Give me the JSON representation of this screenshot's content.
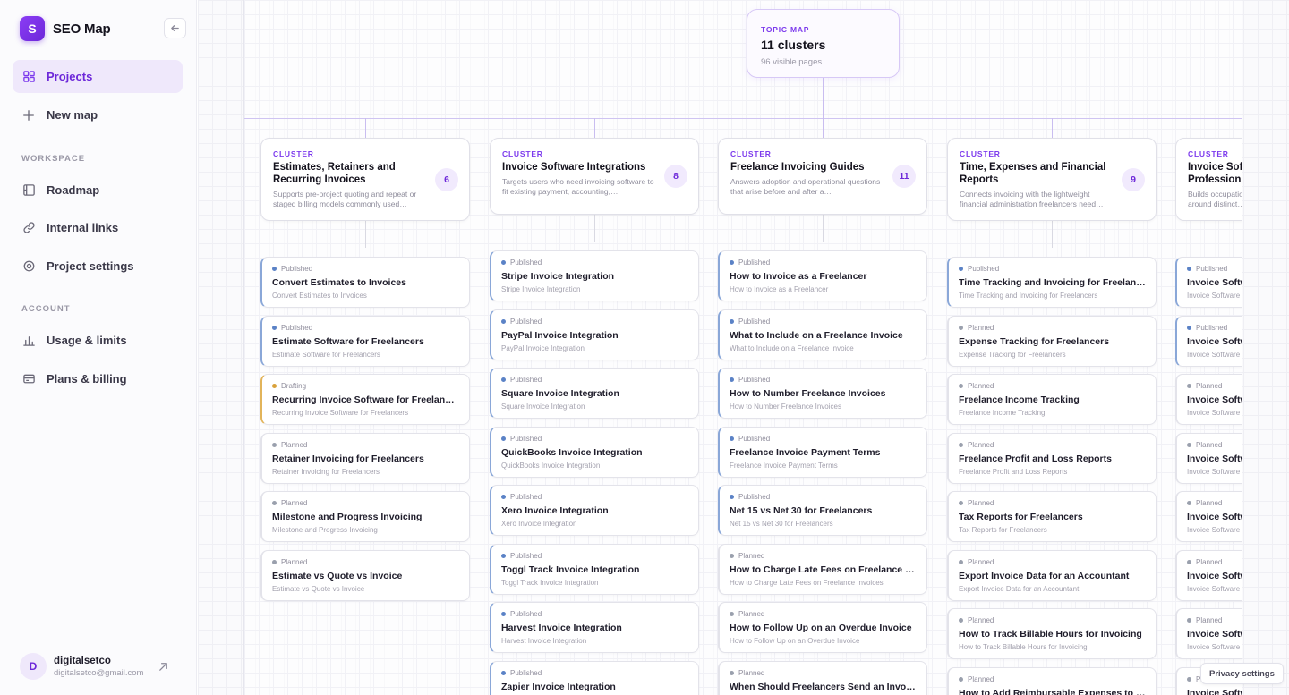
{
  "app": {
    "logo_letter": "S",
    "name": "SEO Map"
  },
  "sidebar": {
    "primary": [
      {
        "label": "Projects",
        "icon": "grid-icon"
      },
      {
        "label": "New map",
        "icon": "plus-icon"
      }
    ],
    "workspace_label": "WORKSPACE",
    "workspace": [
      {
        "label": "Roadmap",
        "icon": "roadmap-icon"
      },
      {
        "label": "Internal links",
        "icon": "link-icon"
      },
      {
        "label": "Project settings",
        "icon": "gear-icon"
      }
    ],
    "account_label": "ACCOUNT",
    "account": [
      {
        "label": "Usage & limits",
        "icon": "bar-chart-icon"
      },
      {
        "label": "Plans & billing",
        "icon": "card-icon"
      }
    ],
    "user": {
      "initial": "D",
      "name": "digitalsetco",
      "email": "digitalsetco@gmail.com"
    }
  },
  "map": {
    "root": {
      "kicker": "TOPIC MAP",
      "title": "11 clusters",
      "subtitle": "96 visible pages"
    },
    "clusters": [
      {
        "kicker": "CLUSTER",
        "title": "Estimates, Retainers and Recurring Invoices",
        "count": "6",
        "description": "Supports pre-project quoting and repeat or staged billing models commonly used…",
        "pages": [
          {
            "status": "Published",
            "title": "Convert Estimates to Invoices",
            "subtitle": "Convert Estimates to Invoices"
          },
          {
            "status": "Published",
            "title": "Estimate Software for Freelancers",
            "subtitle": "Estimate Software for Freelancers"
          },
          {
            "status": "Drafting",
            "title": "Recurring Invoice Software for Freelancers",
            "subtitle": "Recurring Invoice Software for Freelancers"
          },
          {
            "status": "Planned",
            "title": "Retainer Invoicing for Freelancers",
            "subtitle": "Retainer Invoicing for Freelancers"
          },
          {
            "status": "Planned",
            "title": "Milestone and Progress Invoicing",
            "subtitle": "Milestone and Progress Invoicing"
          },
          {
            "status": "Planned",
            "title": "Estimate vs Quote vs Invoice",
            "subtitle": "Estimate vs Quote vs Invoice"
          }
        ]
      },
      {
        "kicker": "CLUSTER",
        "title": "Invoice Software Integrations",
        "count": "8",
        "description": "Targets users who need invoicing software to fit existing payment, accounting,…",
        "pages": [
          {
            "status": "Published",
            "title": "Stripe Invoice Integration",
            "subtitle": "Stripe Invoice Integration"
          },
          {
            "status": "Published",
            "title": "PayPal Invoice Integration",
            "subtitle": "PayPal Invoice Integration"
          },
          {
            "status": "Published",
            "title": "Square Invoice Integration",
            "subtitle": "Square Invoice Integration"
          },
          {
            "status": "Published",
            "title": "QuickBooks Invoice Integration",
            "subtitle": "QuickBooks Invoice Integration"
          },
          {
            "status": "Published",
            "title": "Xero Invoice Integration",
            "subtitle": "Xero Invoice Integration"
          },
          {
            "status": "Published",
            "title": "Toggl Track Invoice Integration",
            "subtitle": "Toggl Track Invoice Integration"
          },
          {
            "status": "Published",
            "title": "Harvest Invoice Integration",
            "subtitle": "Harvest Invoice Integration"
          },
          {
            "status": "Published",
            "title": "Zapier Invoice Integration",
            "subtitle": ""
          }
        ]
      },
      {
        "kicker": "CLUSTER",
        "title": "Freelance Invoicing Guides",
        "count": "11",
        "description": "Answers adoption and operational questions that arise before and after a…",
        "pages": [
          {
            "status": "Published",
            "title": "How to Invoice as a Freelancer",
            "subtitle": "How to Invoice as a Freelancer"
          },
          {
            "status": "Published",
            "title": "What to Include on a Freelance Invoice",
            "subtitle": "What to Include on a Freelance Invoice"
          },
          {
            "status": "Published",
            "title": "How to Number Freelance Invoices",
            "subtitle": "How to Number Freelance Invoices"
          },
          {
            "status": "Published",
            "title": "Freelance Invoice Payment Terms",
            "subtitle": "Freelance Invoice Payment Terms"
          },
          {
            "status": "Published",
            "title": "Net 15 vs Net 30 for Freelancers",
            "subtitle": "Net 15 vs Net 30 for Freelancers"
          },
          {
            "status": "Planned",
            "title": "How to Charge Late Fees on Freelance Invoi…",
            "subtitle": "How to Charge Late Fees on Freelance Invoices"
          },
          {
            "status": "Planned",
            "title": "How to Follow Up on an Overdue Invoice",
            "subtitle": "How to Follow Up on an Overdue Invoice"
          },
          {
            "status": "Planned",
            "title": "When Should Freelancers Send an Invoice?",
            "subtitle": ""
          }
        ]
      },
      {
        "kicker": "CLUSTER",
        "title": "Time, Expenses and Financial Reports",
        "count": "9",
        "description": "Connects invoicing with the lightweight financial administration freelancers need…",
        "pages": [
          {
            "status": "Published",
            "title": "Time Tracking and Invoicing for Freelancers",
            "subtitle": "Time Tracking and Invoicing for Freelancers"
          },
          {
            "status": "Planned",
            "title": "Expense Tracking for Freelancers",
            "subtitle": "Expense Tracking for Freelancers"
          },
          {
            "status": "Planned",
            "title": "Freelance Income Tracking",
            "subtitle": "Freelance Income Tracking"
          },
          {
            "status": "Planned",
            "title": "Freelance Profit and Loss Reports",
            "subtitle": "Freelance Profit and Loss Reports"
          },
          {
            "status": "Planned",
            "title": "Tax Reports for Freelancers",
            "subtitle": "Tax Reports for Freelancers"
          },
          {
            "status": "Planned",
            "title": "Export Invoice Data for an Accountant",
            "subtitle": "Export Invoice Data for an Accountant"
          },
          {
            "status": "Planned",
            "title": "How to Track Billable Hours for Invoicing",
            "subtitle": "How to Track Billable Hours for Invoicing"
          },
          {
            "status": "Planned",
            "title": "How to Add Reimbursable Expenses to an In…",
            "subtitle": ""
          }
        ]
      },
      {
        "kicker": "CLUSTER",
        "title": "Invoice Software by Profession",
        "count": "",
        "description": "Builds occupation-specific landing pages around distinct…",
        "pages": [
          {
            "status": "Published",
            "title": "Invoice Software for Designers",
            "subtitle": "Invoice Software for Designers"
          },
          {
            "status": "Published",
            "title": "Invoice Software for Developers",
            "subtitle": "Invoice Software for Developers"
          },
          {
            "status": "Planned",
            "title": "Invoice Software for Writers",
            "subtitle": "Invoice Software for Writers"
          },
          {
            "status": "Planned",
            "title": "Invoice Software for Photographers",
            "subtitle": "Invoice Software for Photographers"
          },
          {
            "status": "Planned",
            "title": "Invoice Software for Consultants",
            "subtitle": "Invoice Software for Consultants"
          },
          {
            "status": "Planned",
            "title": "Invoice Software for Marketers",
            "subtitle": "Invoice Software for Marketers"
          },
          {
            "status": "Planned",
            "title": "Invoice Software for Coaches",
            "subtitle": "Invoice Software for Coaches"
          },
          {
            "status": "Planned",
            "title": "Invoice Software for Tutors",
            "subtitle": ""
          }
        ]
      }
    ]
  },
  "privacy_label": "Privacy settings",
  "colors": {
    "accent": "#7c3aed",
    "published": "#5b82c6",
    "drafting": "#d9a13a",
    "planned": "#9aa0ad"
  }
}
